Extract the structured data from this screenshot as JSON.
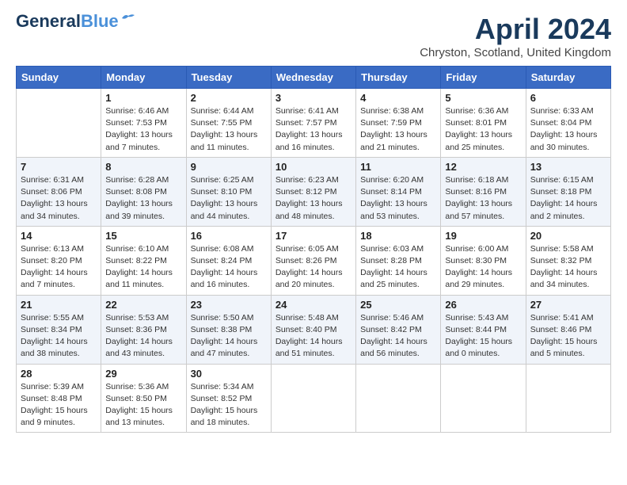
{
  "header": {
    "logo_line1": "General",
    "logo_line2": "Blue",
    "month": "April 2024",
    "location": "Chryston, Scotland, United Kingdom"
  },
  "weekdays": [
    "Sunday",
    "Monday",
    "Tuesday",
    "Wednesday",
    "Thursday",
    "Friday",
    "Saturday"
  ],
  "weeks": [
    [
      {
        "day": "",
        "info": ""
      },
      {
        "day": "1",
        "info": "Sunrise: 6:46 AM\nSunset: 7:53 PM\nDaylight: 13 hours\nand 7 minutes."
      },
      {
        "day": "2",
        "info": "Sunrise: 6:44 AM\nSunset: 7:55 PM\nDaylight: 13 hours\nand 11 minutes."
      },
      {
        "day": "3",
        "info": "Sunrise: 6:41 AM\nSunset: 7:57 PM\nDaylight: 13 hours\nand 16 minutes."
      },
      {
        "day": "4",
        "info": "Sunrise: 6:38 AM\nSunset: 7:59 PM\nDaylight: 13 hours\nand 21 minutes."
      },
      {
        "day": "5",
        "info": "Sunrise: 6:36 AM\nSunset: 8:01 PM\nDaylight: 13 hours\nand 25 minutes."
      },
      {
        "day": "6",
        "info": "Sunrise: 6:33 AM\nSunset: 8:04 PM\nDaylight: 13 hours\nand 30 minutes."
      }
    ],
    [
      {
        "day": "7",
        "info": "Sunrise: 6:31 AM\nSunset: 8:06 PM\nDaylight: 13 hours\nand 34 minutes."
      },
      {
        "day": "8",
        "info": "Sunrise: 6:28 AM\nSunset: 8:08 PM\nDaylight: 13 hours\nand 39 minutes."
      },
      {
        "day": "9",
        "info": "Sunrise: 6:25 AM\nSunset: 8:10 PM\nDaylight: 13 hours\nand 44 minutes."
      },
      {
        "day": "10",
        "info": "Sunrise: 6:23 AM\nSunset: 8:12 PM\nDaylight: 13 hours\nand 48 minutes."
      },
      {
        "day": "11",
        "info": "Sunrise: 6:20 AM\nSunset: 8:14 PM\nDaylight: 13 hours\nand 53 minutes."
      },
      {
        "day": "12",
        "info": "Sunrise: 6:18 AM\nSunset: 8:16 PM\nDaylight: 13 hours\nand 57 minutes."
      },
      {
        "day": "13",
        "info": "Sunrise: 6:15 AM\nSunset: 8:18 PM\nDaylight: 14 hours\nand 2 minutes."
      }
    ],
    [
      {
        "day": "14",
        "info": "Sunrise: 6:13 AM\nSunset: 8:20 PM\nDaylight: 14 hours\nand 7 minutes."
      },
      {
        "day": "15",
        "info": "Sunrise: 6:10 AM\nSunset: 8:22 PM\nDaylight: 14 hours\nand 11 minutes."
      },
      {
        "day": "16",
        "info": "Sunrise: 6:08 AM\nSunset: 8:24 PM\nDaylight: 14 hours\nand 16 minutes."
      },
      {
        "day": "17",
        "info": "Sunrise: 6:05 AM\nSunset: 8:26 PM\nDaylight: 14 hours\nand 20 minutes."
      },
      {
        "day": "18",
        "info": "Sunrise: 6:03 AM\nSunset: 8:28 PM\nDaylight: 14 hours\nand 25 minutes."
      },
      {
        "day": "19",
        "info": "Sunrise: 6:00 AM\nSunset: 8:30 PM\nDaylight: 14 hours\nand 29 minutes."
      },
      {
        "day": "20",
        "info": "Sunrise: 5:58 AM\nSunset: 8:32 PM\nDaylight: 14 hours\nand 34 minutes."
      }
    ],
    [
      {
        "day": "21",
        "info": "Sunrise: 5:55 AM\nSunset: 8:34 PM\nDaylight: 14 hours\nand 38 minutes."
      },
      {
        "day": "22",
        "info": "Sunrise: 5:53 AM\nSunset: 8:36 PM\nDaylight: 14 hours\nand 43 minutes."
      },
      {
        "day": "23",
        "info": "Sunrise: 5:50 AM\nSunset: 8:38 PM\nDaylight: 14 hours\nand 47 minutes."
      },
      {
        "day": "24",
        "info": "Sunrise: 5:48 AM\nSunset: 8:40 PM\nDaylight: 14 hours\nand 51 minutes."
      },
      {
        "day": "25",
        "info": "Sunrise: 5:46 AM\nSunset: 8:42 PM\nDaylight: 14 hours\nand 56 minutes."
      },
      {
        "day": "26",
        "info": "Sunrise: 5:43 AM\nSunset: 8:44 PM\nDaylight: 15 hours\nand 0 minutes."
      },
      {
        "day": "27",
        "info": "Sunrise: 5:41 AM\nSunset: 8:46 PM\nDaylight: 15 hours\nand 5 minutes."
      }
    ],
    [
      {
        "day": "28",
        "info": "Sunrise: 5:39 AM\nSunset: 8:48 PM\nDaylight: 15 hours\nand 9 minutes."
      },
      {
        "day": "29",
        "info": "Sunrise: 5:36 AM\nSunset: 8:50 PM\nDaylight: 15 hours\nand 13 minutes."
      },
      {
        "day": "30",
        "info": "Sunrise: 5:34 AM\nSunset: 8:52 PM\nDaylight: 15 hours\nand 18 minutes."
      },
      {
        "day": "",
        "info": ""
      },
      {
        "day": "",
        "info": ""
      },
      {
        "day": "",
        "info": ""
      },
      {
        "day": "",
        "info": ""
      }
    ]
  ]
}
